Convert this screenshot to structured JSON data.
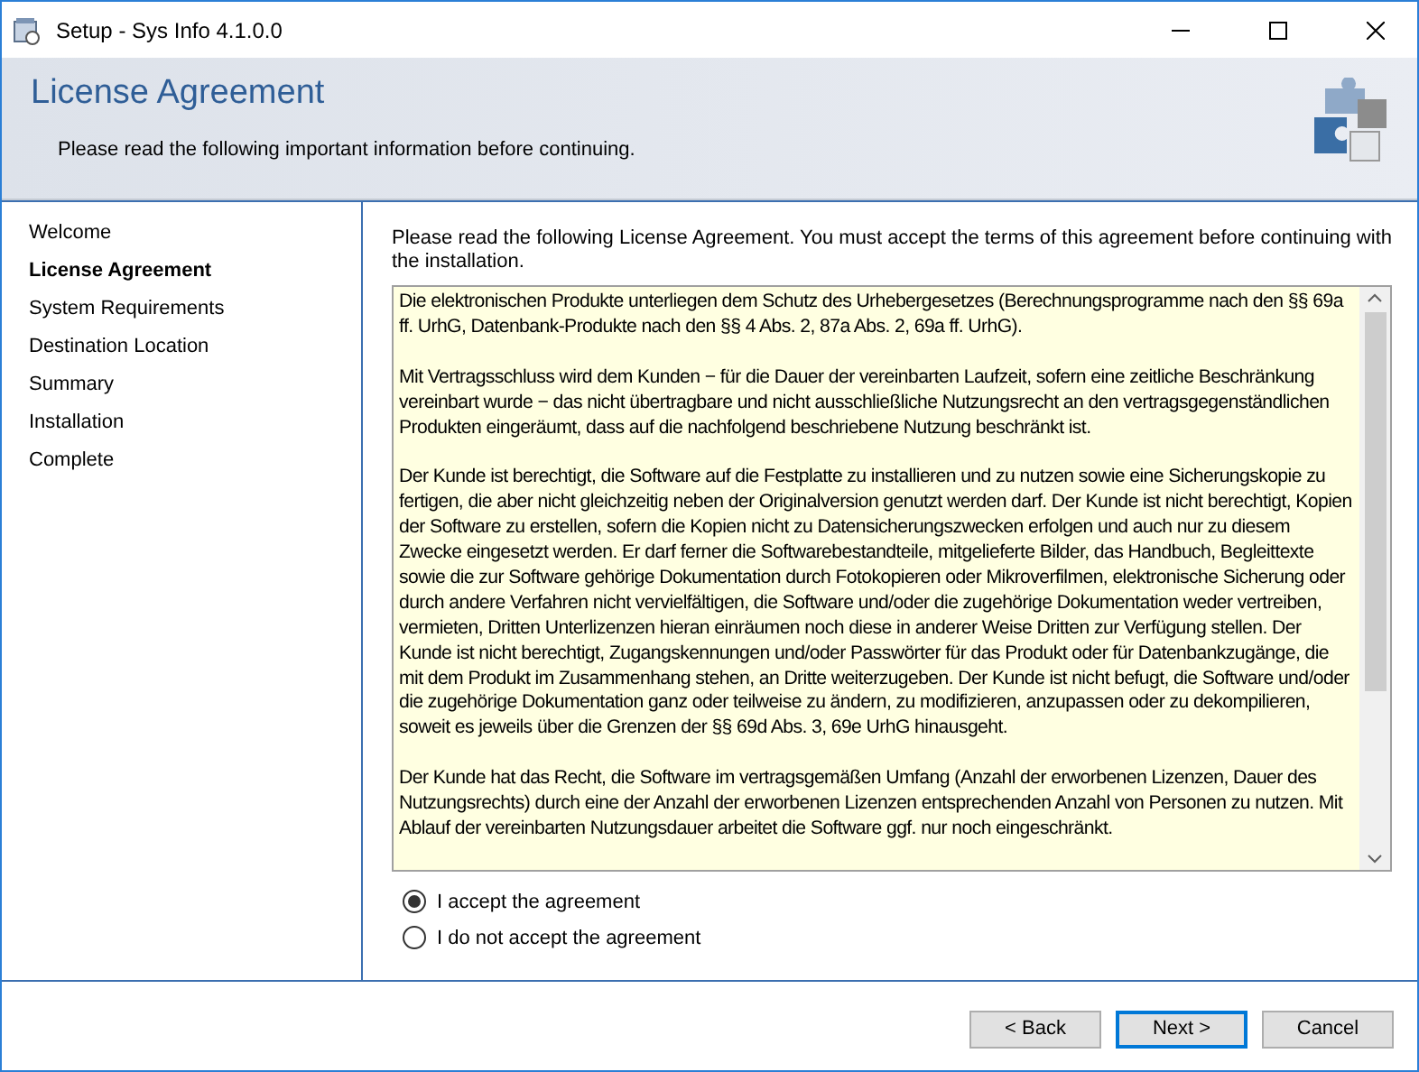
{
  "window": {
    "title": "Setup - Sys Info 4.1.0.0"
  },
  "header": {
    "title": "License Agreement",
    "subtitle": "Please read the following important information before continuing."
  },
  "steps": [
    {
      "label": "Welcome",
      "selected": false
    },
    {
      "label": "License Agreement",
      "selected": true
    },
    {
      "label": "System Requirements",
      "selected": false
    },
    {
      "label": "Destination Location",
      "selected": false
    },
    {
      "label": "Summary",
      "selected": false
    },
    {
      "label": "Installation",
      "selected": false
    },
    {
      "label": "Complete",
      "selected": false
    }
  ],
  "intro": "Please read the following License Agreement. You must accept the terms of this agreement before continuing with the installation.",
  "license": [
    "Die elektronischen Produkte unterliegen dem Schutz des Urhebergesetzes (Berechnungsprogramme nach den §§ 69a ff. UrhG, Datenbank-Produkte nach den §§ 4 Abs. 2, 87a Abs. 2, 69a ff. UrhG).",
    "Mit Vertragsschluss wird dem Kunden − für die Dauer der vereinbarten Laufzeit, sofern eine zeitliche Beschränkung vereinbart wurde − das nicht übertragbare und nicht ausschließliche Nutzungsrecht an den vertragsgegenständlichen Produkten eingeräumt, dass auf die nachfolgend beschriebene Nutzung beschränkt ist.",
    "Der Kunde ist berechtigt, die Software auf die Festplatte zu installieren und zu nutzen sowie eine Sicherungskopie zu fertigen, die aber nicht gleichzeitig neben der Originalversion genutzt werden darf. Der Kunde ist nicht berechtigt, Kopien der Software zu erstellen, sofern die Kopien nicht zu Datensicherungszwecken erfolgen und auch nur zu diesem Zwecke eingesetzt werden. Er darf ferner die Softwarebestandteile, mitgelieferte Bilder, das Handbuch, Begleittexte sowie die zur Software gehörige Dokumentation durch Fotokopieren oder Mikroverfilmen, elektronische Sicherung oder durch andere Verfahren nicht vervielfältigen, die Software und/oder die zugehörige Dokumentation weder vertreiben, vermieten, Dritten Unterlizenzen hieran einräumen noch diese in anderer Weise Dritten zur Verfügung stellen. Der Kunde ist nicht berechtigt, Zugangskennungen und/oder Passwörter für das Produkt oder für Datenbankzugänge, die mit dem Produkt im Zusammenhang stehen, an Dritte weiterzugeben. Der Kunde ist nicht befugt, die Software und/oder die zugehörige Dokumentation ganz oder teilweise zu ändern, zu modifizieren, anzupassen oder zu dekompilieren, soweit es jeweils über die Grenzen der §§ 69d Abs. 3, 69e UrhG hinausgeht.",
    "Der Kunde hat das Recht, die Software im vertragsgemäßen Umfang (Anzahl der erworbenen Lizenzen, Dauer des Nutzungsrechts) durch eine der Anzahl der erworbenen Lizenzen entsprechenden Anzahl von Personen zu nutzen. Mit Ablauf der vereinbarten Nutzungsdauer arbeitet die Software ggf. nur noch eingeschränkt."
  ],
  "options": [
    {
      "label": "I accept the agreement",
      "selected": true
    },
    {
      "label": "I do not accept the agreement",
      "selected": false
    }
  ],
  "buttons": [
    {
      "label": "< Back",
      "default": false
    },
    {
      "label": "Next >",
      "default": true
    },
    {
      "label": "Cancel",
      "default": false
    }
  ]
}
